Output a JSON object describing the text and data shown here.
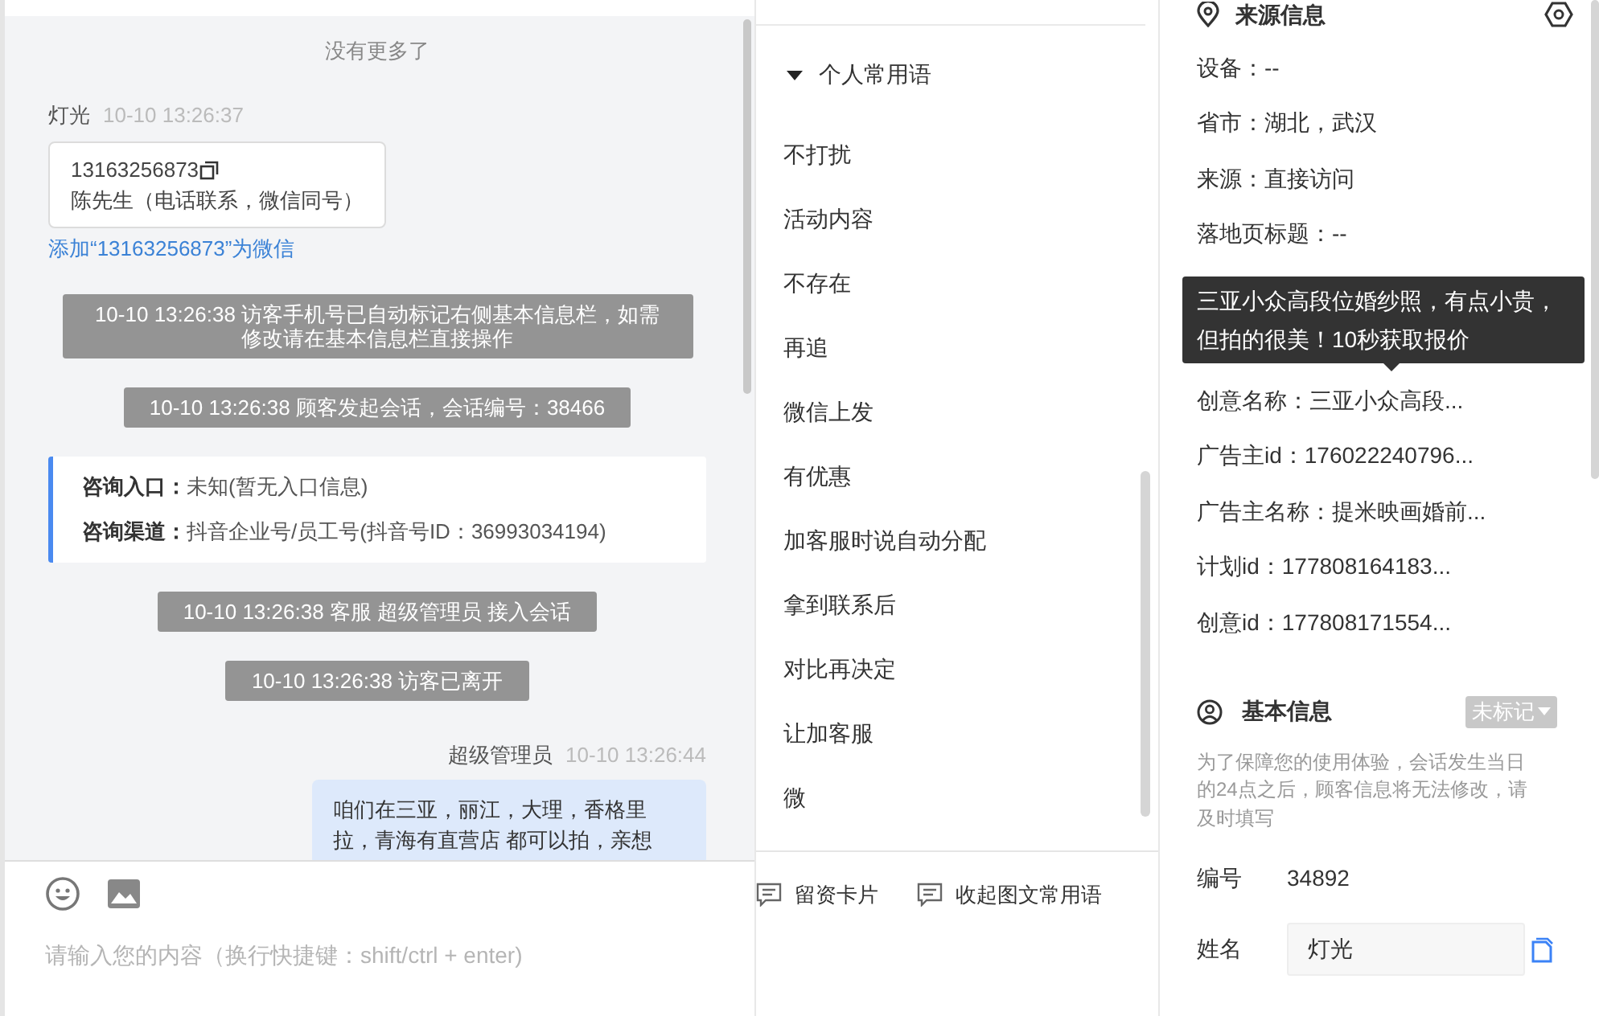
{
  "chat": {
    "notice": "没有更多了",
    "messages": [
      {
        "kind": "visitor",
        "sender": "灯光",
        "time": "10-10 13:26:37",
        "card_lines": [
          "13163256873",
          "陈先生（电话联系，微信同号）"
        ],
        "link": "添加“13163256873”为微信"
      },
      {
        "kind": "system",
        "text": "10-10 13:26:38 访客手机号已自动标记右侧基本信息栏，如需修改请在基本信息栏直接操作"
      },
      {
        "kind": "system",
        "text": "10-10 13:26:38 顾客发起会话，会话编号：38466"
      },
      {
        "kind": "info",
        "fields": [
          {
            "label": "咨询入口：",
            "value": "未知(暂无入口信息)"
          },
          {
            "label": "咨询渠道：",
            "value": "抖音企业号/员工号(抖音号ID：36993034194)"
          }
        ]
      },
      {
        "kind": "system",
        "text": "10-10 13:26:38 客服 超级管理员 接入会话"
      },
      {
        "kind": "system",
        "text": "10-10 13:26:38 访客已离开"
      },
      {
        "kind": "agent",
        "sender": "超级管理员",
        "time": "10-10 13:26:44",
        "text": "咱们在三亚，丽江，大理，香格里拉，青海有直营店 都可以拍，亲想"
      }
    ]
  },
  "input": {
    "placeholder": "请输入您的内容（换行快捷键：shift/ctrl + enter)"
  },
  "phrases": {
    "group": {
      "label": "个人常用语",
      "expanded": true
    },
    "items": [
      "不打扰",
      "活动内容",
      "不存在",
      "再追",
      "微信上发",
      "有优惠",
      "加客服时说自动分配",
      "拿到联系后",
      "对比再决定",
      "让加客服",
      "微"
    ],
    "buttons": [
      "留资卡片",
      "收起图文常用语"
    ]
  },
  "source": {
    "title": "来源信息",
    "rows": [
      "设备：--",
      "省市：湖北，武汉",
      "来源：直接访问",
      "落地页标题：--",
      "创意名称：三亚小众高段...",
      "广告主id：176022240796...",
      "广告主名称：提米映画婚前...",
      "计划id：177808164183...",
      "创意id：177808171554..."
    ],
    "tooltip": "三亚小众高段位婚纱照，有点小贵，但拍的很美！10秒获取报价"
  },
  "basic": {
    "title": "基本信息",
    "tag": "未标记",
    "note": "为了保障您的使用体验，会话发生当日的24点之后，顾客信息将无法修改，请及时填写",
    "fields": [
      {
        "kind": "text",
        "label": "编号",
        "value": "34892"
      },
      {
        "kind": "input",
        "label": "姓名",
        "value": "灯光"
      }
    ]
  }
}
